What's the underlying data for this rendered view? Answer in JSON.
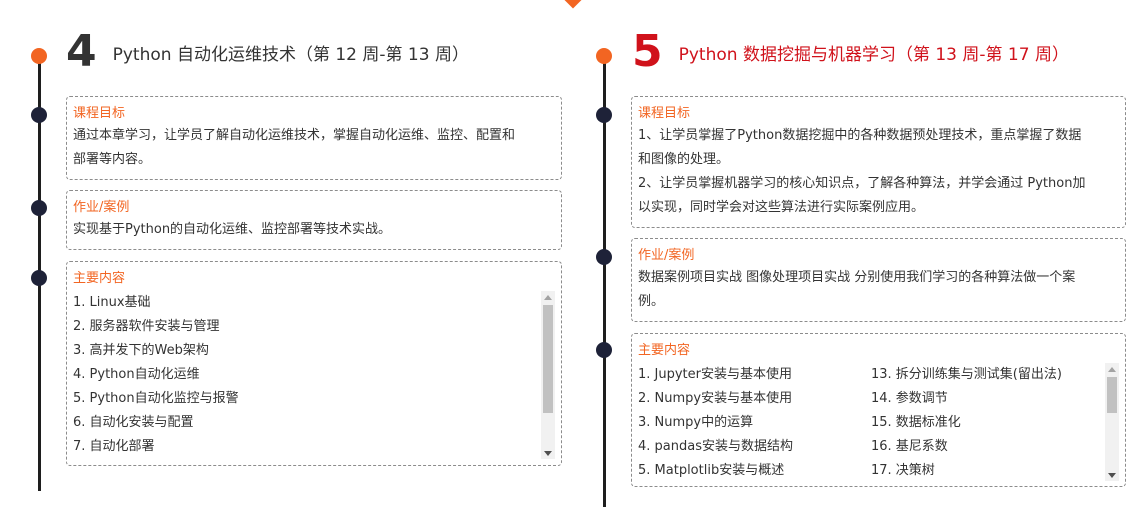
{
  "accent_color": "#f26522",
  "red_color": "#d0121b",
  "left": {
    "number": "4",
    "title": "Python 自动化运维技术（第 12 周-第 13 周）",
    "goal": {
      "label": "课程目标",
      "text_lines": [
        "通过本章学习，让学员了解自动化运维技术，掌握自动化运维、监控、配置和",
        "部署等内容。"
      ]
    },
    "homework": {
      "label": "作业/案例",
      "text_lines": [
        "实现基于Python的自动化运维、监控部署等技术实战。"
      ]
    },
    "content": {
      "label": "主要内容",
      "items": [
        "1. Linux基础",
        "2. 服务器软件安装与管理",
        "3. 高并发下的Web架构",
        "4. Python自动化运维",
        "5. Python自动化监控与报警",
        "6. 自动化安装与配置",
        "7. 自动化部署"
      ]
    }
  },
  "right": {
    "number": "5",
    "title": "Python 数据挖掘与机器学习（第 13 周-第 17 周）",
    "goal": {
      "label": "课程目标",
      "text_lines": [
        "1、让学员掌握了Python数据挖掘中的各种数据预处理技术，重点掌握了数据",
        "和图像的处理。",
        "2、让学员掌握机器学习的核心知识点，了解各种算法，并学会通过 Python加",
        "以实现，同时学会对这些算法进行实际案例应用。"
      ]
    },
    "homework": {
      "label": "作业/案例",
      "text_lines": [
        "数据案例项目实战 图像处理项目实战 分别使用我们学习的各种算法做一个案",
        "例。"
      ]
    },
    "content": {
      "label": "主要内容",
      "col1": [
        "1. Jupyter安装与基本使用",
        "2. Numpy安装与基本使用",
        "3. Numpy中的运算",
        "4. pandas安装与数据结构",
        "5. Matplotlib安装与概述"
      ],
      "col2": [
        "13. 拆分训练集与测试集(留出法)",
        "14. 参数调节",
        "15. 数据标准化",
        "16. 基尼系数",
        "17. 决策树"
      ]
    }
  }
}
